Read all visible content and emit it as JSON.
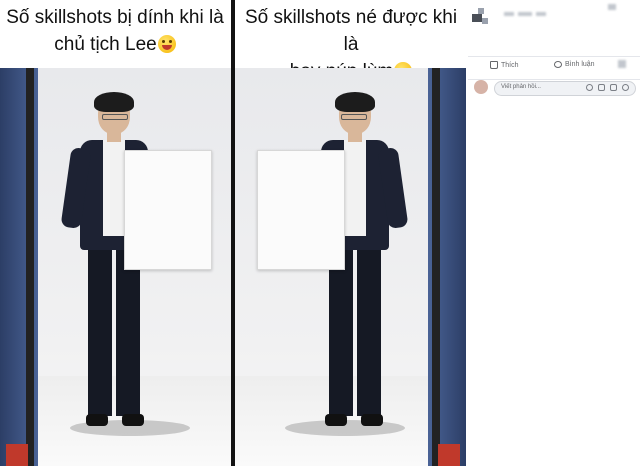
{
  "meme": {
    "left_caption_line1": "Số skillshots bị dính khi là",
    "left_caption_line2": "chủ tịch Lee",
    "right_caption_line1": "Số skillshots né được khi là",
    "right_caption_line2": "boy núp lùm",
    "left_emoji": "yum-face-emoji",
    "right_emoji": "unamused-face-emoji"
  },
  "post_actions": {
    "like_label": "Thích",
    "comment_label": "Bình luận"
  },
  "comment_box": {
    "placeholder": "Viết phản hồi...",
    "icons": [
      "emoji-icon",
      "camera-icon",
      "gif-icon",
      "sticker-icon"
    ]
  },
  "colors": {
    "link_text": "#65676b",
    "field_bg": "#f0f2f5",
    "studio_blue": "#3a5282"
  }
}
